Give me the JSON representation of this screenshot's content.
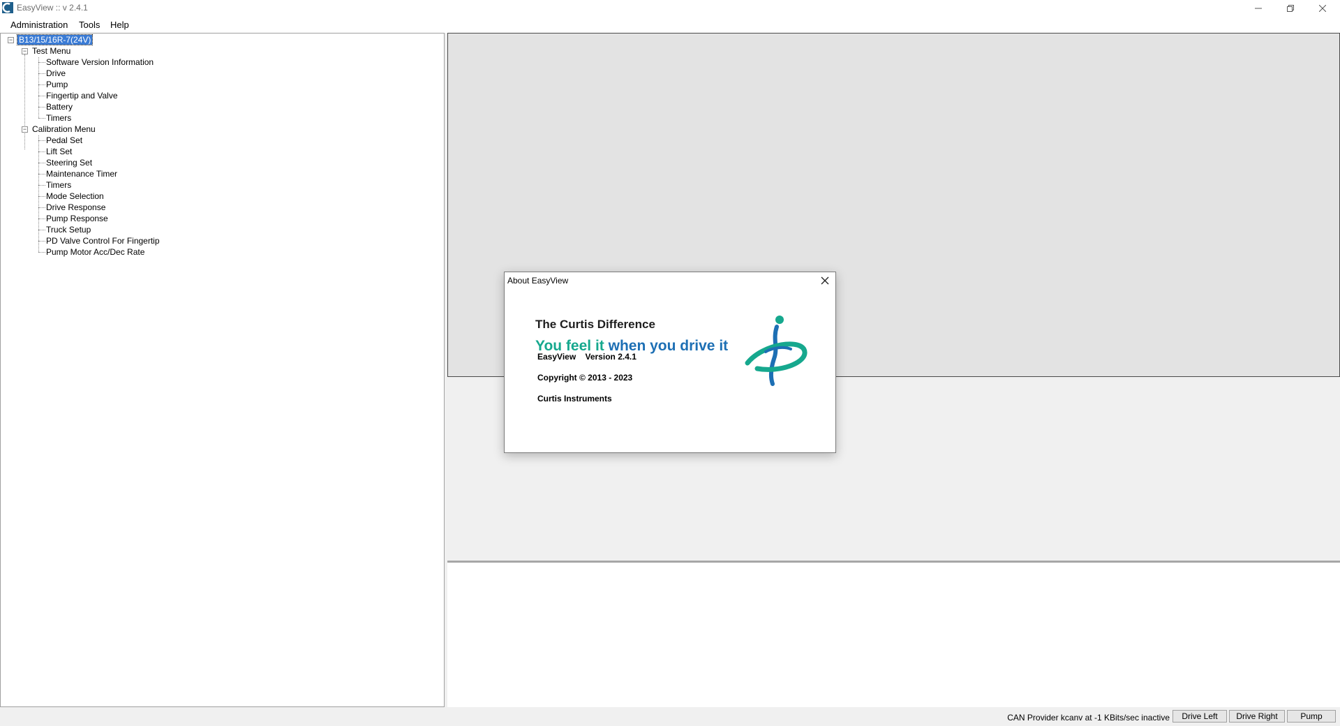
{
  "window": {
    "title": "EasyView :: v 2.4.1",
    "controls": [
      "minimize-icon",
      "restore-icon",
      "close-icon"
    ]
  },
  "menu": {
    "items": [
      {
        "label": "Administration"
      },
      {
        "label": "Tools"
      },
      {
        "label": "Help"
      }
    ]
  },
  "tree": {
    "root": "B13/15/16R-7(24V)",
    "groups": [
      {
        "label": "Test Menu",
        "items": [
          "Software Version Information",
          "Drive",
          "Pump",
          "Fingertip and Valve",
          "Battery",
          "Timers"
        ]
      },
      {
        "label": "Calibration Menu",
        "items": [
          "Pedal Set",
          "Lift Set",
          "Steering Set",
          "Maintenance Timer",
          "Timers",
          "Mode Selection",
          "Drive Response",
          "Pump Response",
          "Truck Setup",
          "PD Valve Control For Fingertip",
          "Pump Motor Acc/Dec Rate"
        ]
      }
    ]
  },
  "about": {
    "title": "About EasyView",
    "heading": "The Curtis Difference",
    "slogan_part1": "You feel it ",
    "slogan_part2": "when you drive it",
    "product": "EasyView",
    "version": "Version 2.4.1",
    "copyright": "Copyright © 2013 - 2023",
    "company": "Curtis Instruments",
    "colors": {
      "teal": "#16a88e",
      "blue": "#1d6fb4"
    }
  },
  "status": {
    "text": "CAN Provider kcanv at -1 KBits/sec inactive",
    "buttons": [
      "Drive Left",
      "Drive Right",
      "Pump"
    ]
  }
}
